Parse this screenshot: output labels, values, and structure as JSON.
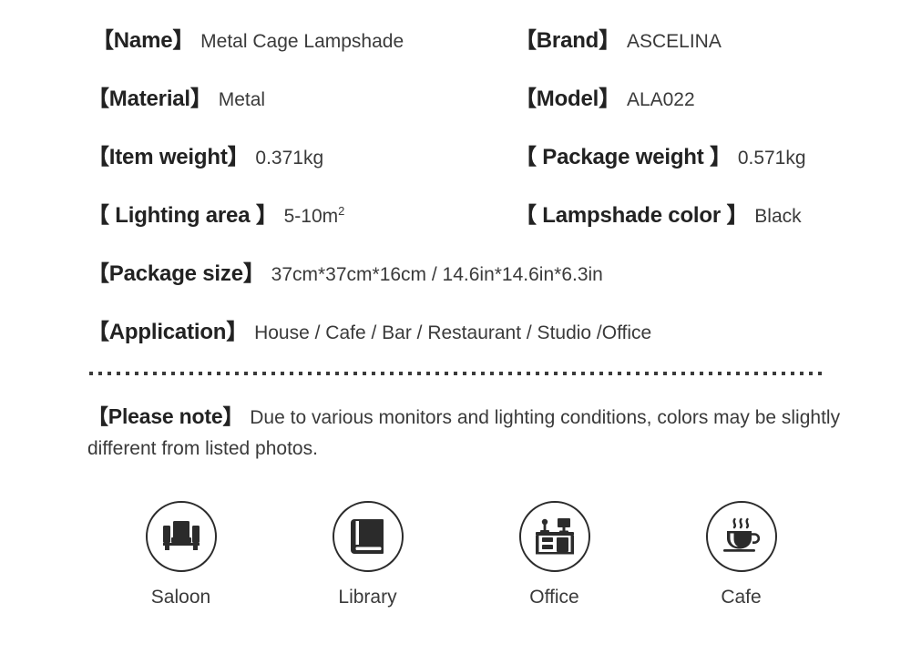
{
  "specs": {
    "rows": [
      {
        "left": {
          "label": "【Name】",
          "value": "Metal Cage Lampshade"
        },
        "right": {
          "label": "【Brand】",
          "value": "ASCELINA"
        }
      },
      {
        "left": {
          "label": "【Material】",
          "value": "Metal"
        },
        "right": {
          "label": "【Model】",
          "value": "ALA022"
        }
      },
      {
        "left": {
          "label": "【Item weight】",
          "value": "0.371kg"
        },
        "right": {
          "label": "【 Package weight 】",
          "value": "0.571kg"
        }
      },
      {
        "left": {
          "label": "【 Lighting area 】",
          "value": "5-10m",
          "superscript": "2"
        },
        "right": {
          "label": "【 Lampshade color 】",
          "value": "Black"
        }
      }
    ],
    "package_size": {
      "label": "【Package size】",
      "value": "37cm*37cm*16cm / 14.6in*14.6in*6.3in"
    },
    "application": {
      "label": "【Application】",
      "value": "House / Cafe / Bar / Restaurant / Studio /Office"
    }
  },
  "note": {
    "label": "【Please note】",
    "text": "Due to various monitors and lighting conditions, colors may be slightly different from listed photos."
  },
  "badges": [
    {
      "label": "Saloon",
      "icon": "sofa-icon"
    },
    {
      "label": "Library",
      "icon": "book-icon"
    },
    {
      "label": "Office",
      "icon": "desk-icon"
    },
    {
      "label": "Cafe",
      "icon": "coffee-cup-icon"
    }
  ],
  "colors": {
    "background": "#ffffff",
    "label_text": "#222222",
    "value_text": "#3a3a3a",
    "icon": "#2b2b2b"
  }
}
